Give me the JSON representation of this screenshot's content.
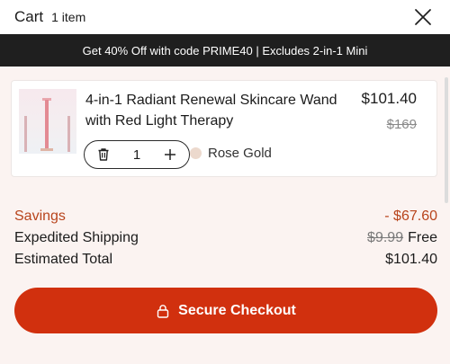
{
  "header": {
    "title": "Cart",
    "count": "1 item"
  },
  "promo": {
    "text": "Get 40% Off with code PRIME40 | Excludes 2-in-1 Mini"
  },
  "item": {
    "name": "4-in-1 Radiant Renewal Skincare Wand with Red Light Therapy",
    "price": "$101.40",
    "original_price": "$169",
    "quantity": "1",
    "variant": "Rose Gold",
    "variant_color": "#ecd9cd"
  },
  "summary": {
    "savings_label": "Savings",
    "savings_value": "- $67.60",
    "shipping_label": "Expedited Shipping",
    "shipping_original": "$9.99",
    "shipping_value": "Free",
    "total_label": "Estimated Total",
    "total_value": "$101.40"
  },
  "checkout": {
    "label": "Secure Checkout"
  },
  "colors": {
    "accent": "#d1300e",
    "savings": "#b8441c",
    "promo_bg": "#1f1f1f"
  },
  "icons": [
    "close-icon",
    "trash-icon",
    "plus-icon",
    "lock-icon"
  ]
}
